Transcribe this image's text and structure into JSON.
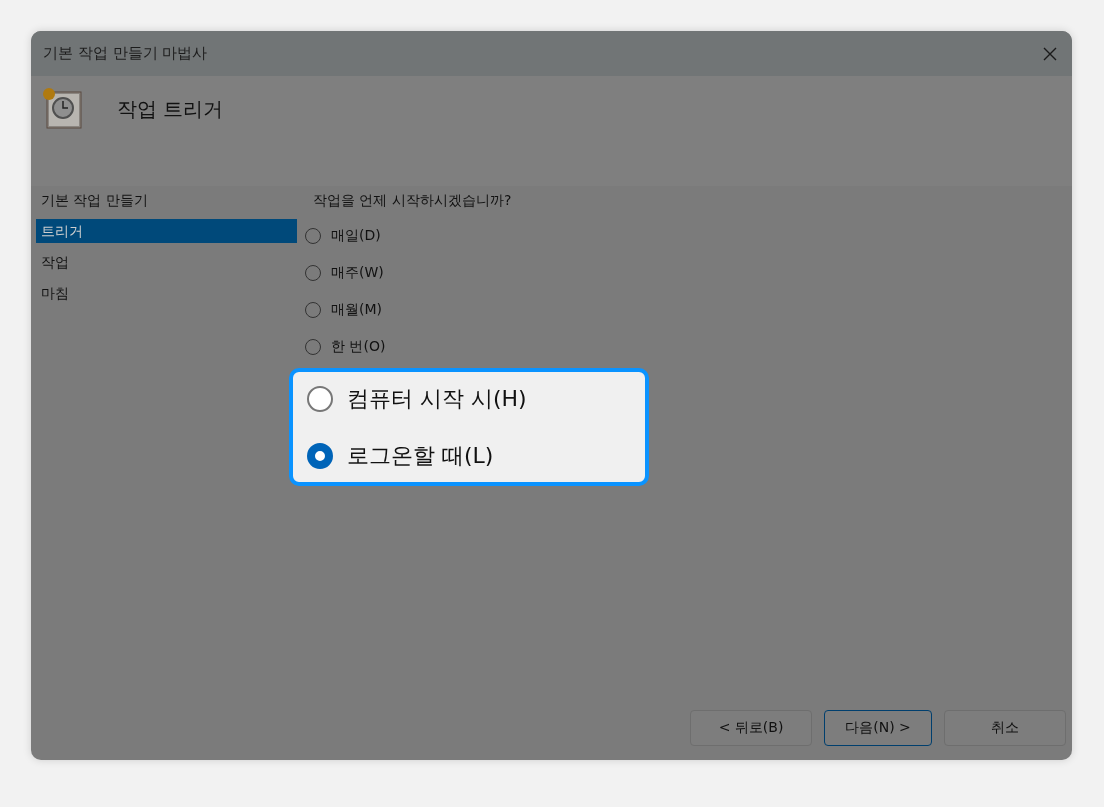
{
  "window": {
    "title": "기본 작업 만들기 마법사"
  },
  "header": {
    "title": "작업 트리거"
  },
  "sidebar": {
    "items": [
      {
        "label": "기본 작업 만들기",
        "selected": false
      },
      {
        "label": "트리거",
        "selected": true
      },
      {
        "label": "작업",
        "selected": false
      },
      {
        "label": "마침",
        "selected": false
      }
    ]
  },
  "question": "작업을 언제 시작하시겠습니까?",
  "options": [
    {
      "label": "매일(D)",
      "selected": false,
      "highlighted": false
    },
    {
      "label": "매주(W)",
      "selected": false,
      "highlighted": false
    },
    {
      "label": "매월(M)",
      "selected": false,
      "highlighted": false
    },
    {
      "label": "한 번(O)",
      "selected": false,
      "highlighted": false
    },
    {
      "label": "컴퓨터 시작 시(H)",
      "selected": false,
      "highlighted": true
    },
    {
      "label": "로그온할 때(L)",
      "selected": true,
      "highlighted": true
    }
  ],
  "buttons": [
    {
      "label": "< 뒤로(B)",
      "default": false
    },
    {
      "label": "다음(N) >",
      "default": true
    },
    {
      "label": "취소",
      "default": false
    }
  ]
}
